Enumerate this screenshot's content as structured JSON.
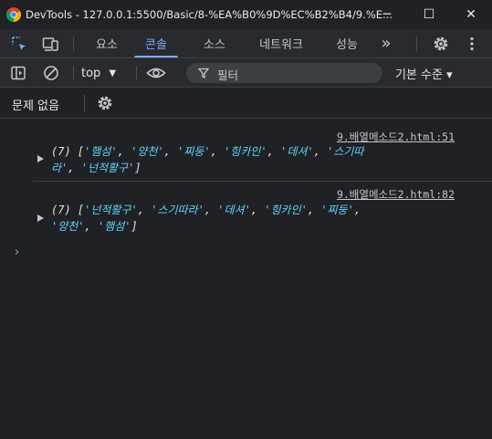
{
  "window": {
    "title": "DevTools - 127.0.0.1:5500/Basic/8-%EA%B0%9D%EC%B2%B4/9.%E...",
    "minimize_icon": "─",
    "maximize_icon": "☐",
    "close_icon": "✕"
  },
  "tabs": [
    {
      "label": "요소"
    },
    {
      "label": "콘솔"
    },
    {
      "label": "소스"
    },
    {
      "label": "네트워크"
    },
    {
      "label": "성능"
    }
  ],
  "tab_overflow": "»",
  "toolbar": {
    "context": "top",
    "filter_placeholder": "필터",
    "levels": "기본 수준 ▾"
  },
  "issues": {
    "label": "문제 없음"
  },
  "messages": [
    {
      "source": "9.배열메소드2.html:51",
      "count": "(7) [",
      "items": [
        "'햄섬'",
        "'양천'",
        "'찌둥'",
        "'힝카인'",
        "'데셔'",
        "'스기따라'",
        "'넌적활구'"
      ],
      "line1_items": [
        "'햄섬'",
        "'양천'",
        "'찌둥'",
        "'힝카인'",
        "'데셔'"
      ],
      "line1_tail": "'스기따",
      "line2_head": "라'",
      "line2_items": [
        "'넌적활구'"
      ]
    },
    {
      "source": "9.배열메소드2.html:82",
      "count": "(7) [",
      "items": [
        "'넌적활구'",
        "'스기따라'",
        "'데셔'",
        "'힝카인'",
        "'찌둥'",
        "'양천'",
        "'햄섬'"
      ]
    }
  ],
  "prompt_glyph": "›",
  "colors": {
    "background": "#202124",
    "toolbar": "#282a2d",
    "accent": "#7cacf8",
    "string": "#5cd5fb"
  }
}
